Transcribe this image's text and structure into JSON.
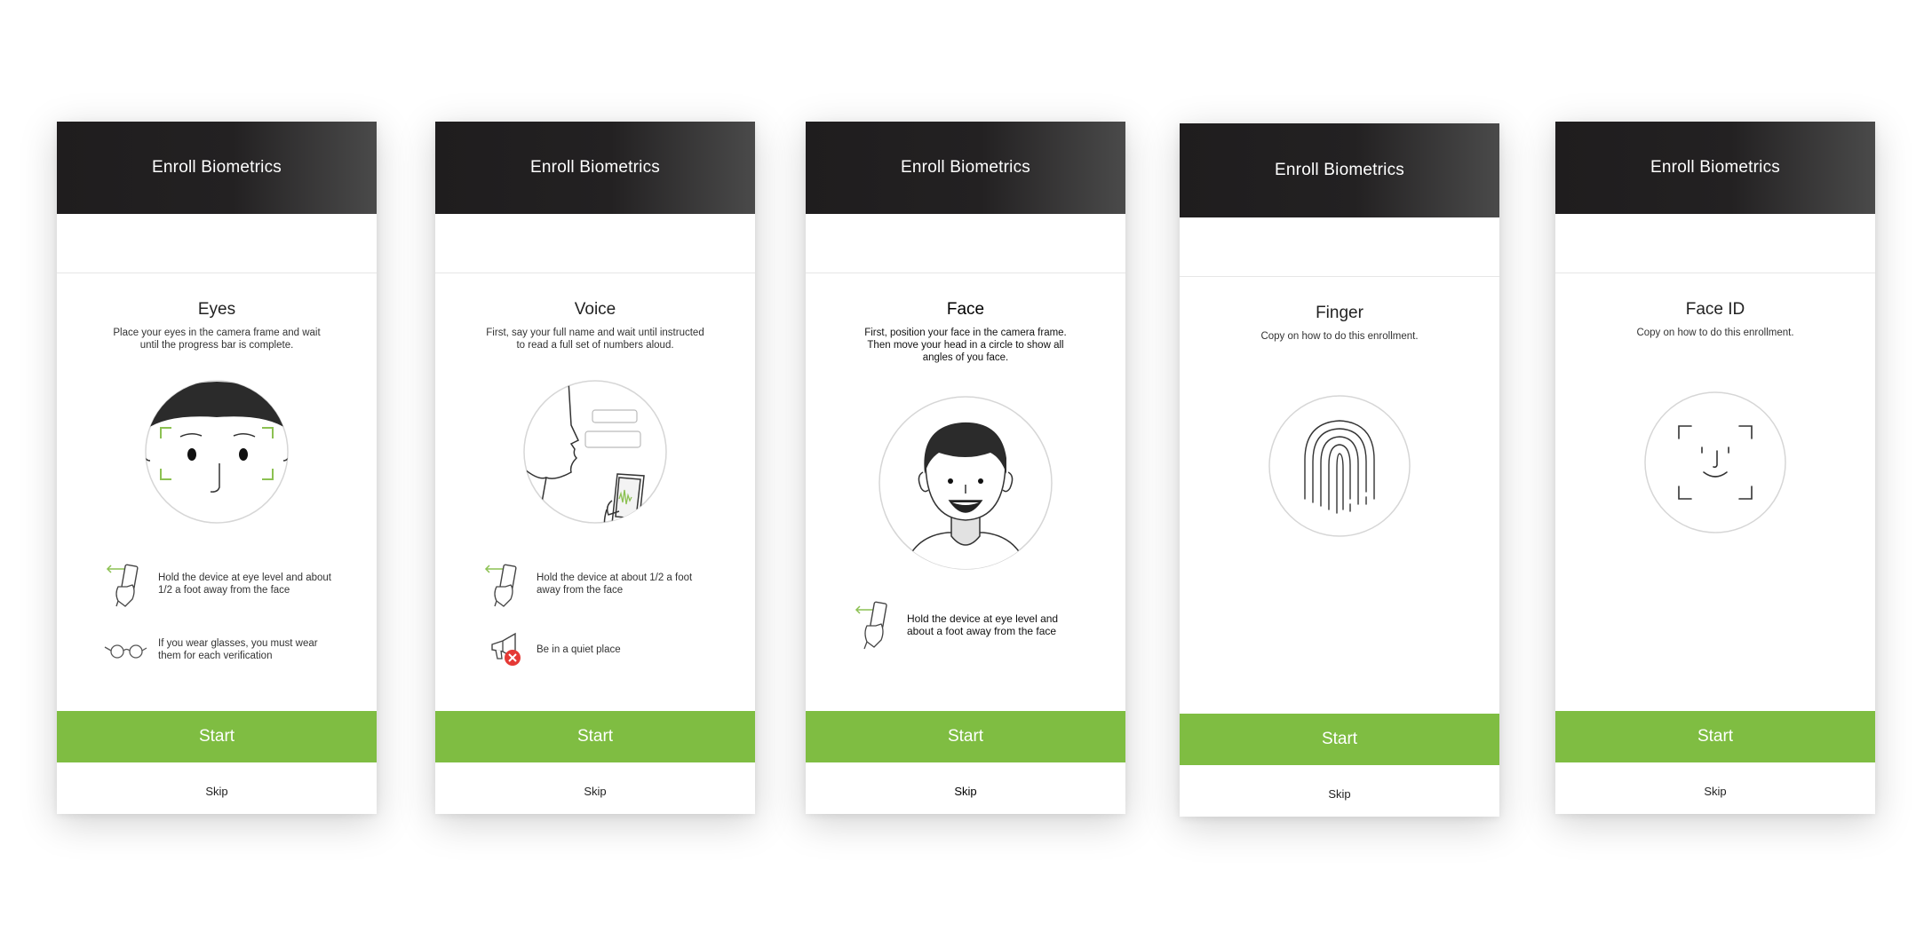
{
  "colors": {
    "header_dark": "#1f1d1e",
    "accent_green": "#7fbd42",
    "frame_green": "#8cc152",
    "alert_red": "#e53935"
  },
  "screens": [
    {
      "header": "Enroll Biometrics",
      "title": "Eyes",
      "description": "Place your eyes in the camera frame and wait until the progress bar is complete.",
      "tips": [
        {
          "icon": "hand-phone-icon",
          "text": "Hold the device at eye level and about 1/2 a foot away from the face"
        },
        {
          "icon": "glasses-icon",
          "text": "If you wear glasses, you must wear them for each verification"
        }
      ],
      "start_label": "Start",
      "skip_label": "Skip"
    },
    {
      "header": "Enroll Biometrics",
      "title": "Voice",
      "description": "First, say your full name and wait until instructed to read a full set of numbers aloud.",
      "tips": [
        {
          "icon": "hand-phone-icon",
          "text": "Hold the device at about 1/2 a foot away from the face"
        },
        {
          "icon": "megaphone-muted-icon",
          "text": "Be in a quiet place"
        }
      ],
      "start_label": "Start",
      "skip_label": "Skip"
    },
    {
      "header": "Enroll Biometrics",
      "title": "Face",
      "description": "First, position your face in the camera frame. Then move your head in a circle to show all angles of you face.",
      "tips": [
        {
          "icon": "hand-phone-icon",
          "text": "Hold the device at eye level and about a foot away from the face"
        }
      ],
      "start_label": "Start",
      "skip_label": "Skip"
    },
    {
      "header": "Enroll Biometrics",
      "title": "Finger",
      "description": "Copy on how to do this enrollment.",
      "tips": [],
      "start_label": "Start",
      "skip_label": "Skip"
    },
    {
      "header": "Enroll Biometrics",
      "title": "Face ID",
      "description": "Copy on how to do this enrollment.",
      "tips": [],
      "start_label": "Start",
      "skip_label": "Skip"
    }
  ]
}
